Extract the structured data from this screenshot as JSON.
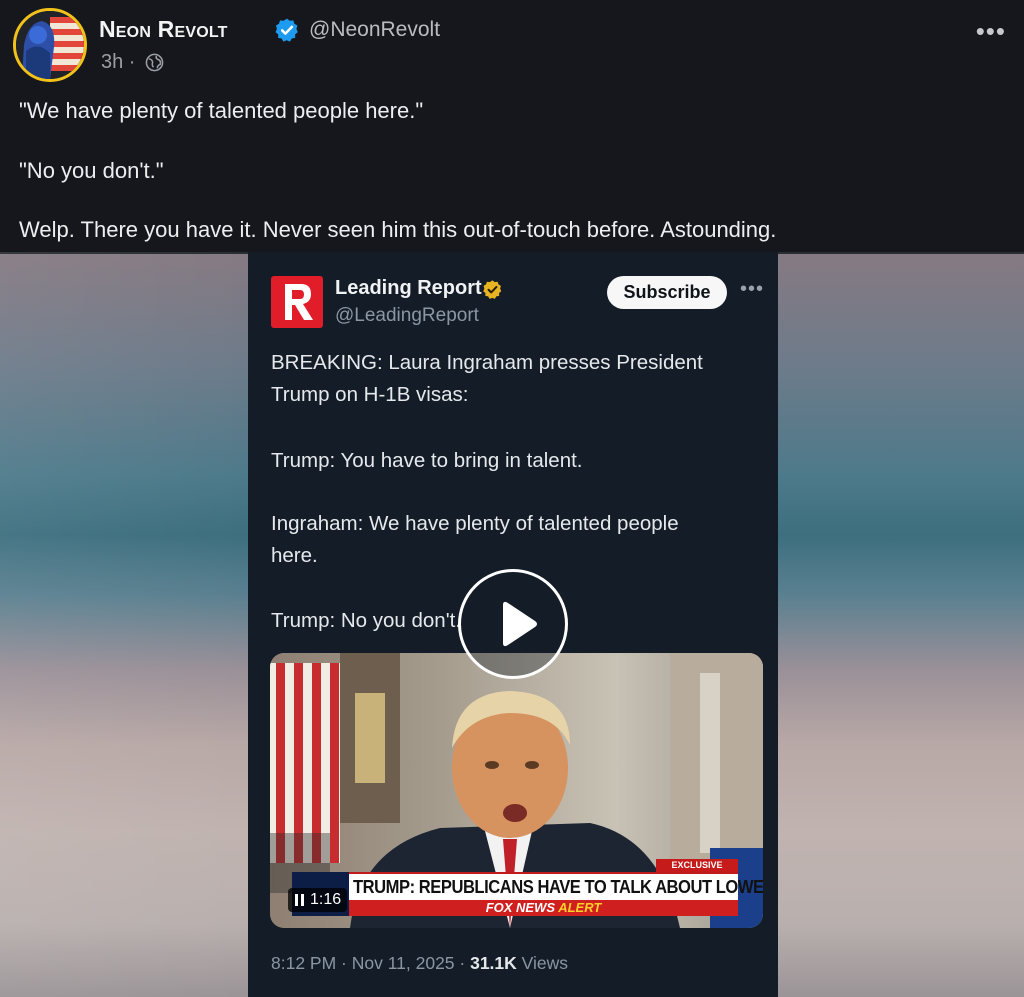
{
  "post": {
    "author_name": "Neon Revolt",
    "handle": "@NeonRevolt",
    "time": "3h ·",
    "text": [
      "\"We have plenty of talented people here.\"",
      "\"No you don't.\"",
      "Welp. There you have it. Never seen him this out-of-touch before. Astounding."
    ]
  },
  "embedded": {
    "author_name": "Leading Report",
    "handle": "@LeadingReport",
    "subscribe_label": "Subscribe",
    "text": [
      "BREAKING: Laura Ingraham presses President",
      "Trump on H-1B visas:",
      "Trump: You have to bring in talent.",
      "Ingraham: We have plenty of talented people",
      "here.",
      "Trump: No you don't."
    ],
    "video": {
      "chyron": "TRUMP: REPUBLICANS HAVE TO TALK ABOUT LOWER PRICES",
      "alert_prefix": "FOX NEWS",
      "alert_suffix": "ALERT",
      "exclusive": "EXCLUSIVE",
      "duration": "1:16"
    },
    "date_time": "8:12 PM · Nov 11, 2025 ·",
    "views_count": "31.1K",
    "views_label": "Views"
  },
  "colors": {
    "background": "#15171c",
    "card_background": "#141c27",
    "verified_blue": "#1d9bf0",
    "verified_gold": "#e8b421",
    "logo_red": "#e21d2a"
  },
  "icons": [
    "verified-badge-icon",
    "globe-icon",
    "more-icon",
    "gold-badge-icon",
    "play-icon",
    "pause-icon"
  ]
}
